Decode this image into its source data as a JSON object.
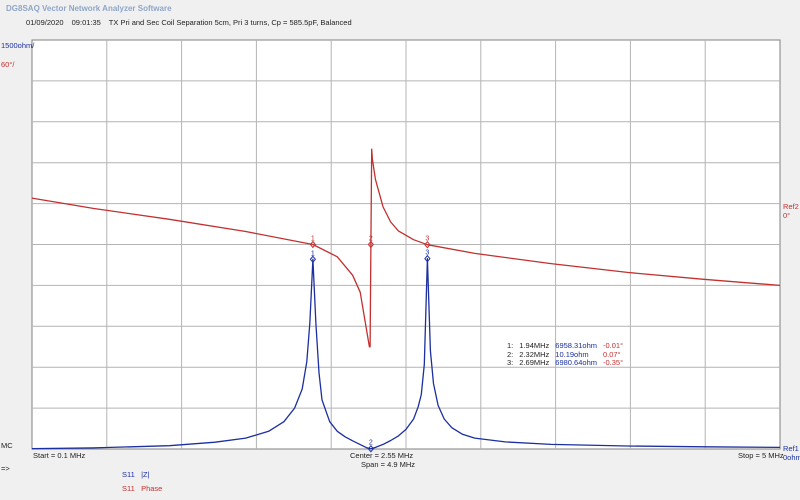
{
  "app_title": "DG8SAQ Vector Network Analyzer Software",
  "header": {
    "date": "01/09/2020",
    "time": "09:01:35",
    "description": "TX Pri and Sec Coil Separation 5cm, Pri 3 turns, Cp = 585.5pF, Balanced"
  },
  "axis_left": {
    "top_primary": "1500ohm/",
    "top_secondary": "60°/",
    "bottom": "MC"
  },
  "axis_right": {
    "ref2_label": "Ref2",
    "ref2_value": "0°",
    "ref1_label": "Ref1",
    "ref1_value": "0ohm"
  },
  "footer": {
    "start": "Start = 0.1 MHz",
    "center": "Center = 2.55 MHz",
    "span": "Span = 4.9 MHz",
    "stop": "Stop = 5 MHz",
    "arrow": "=>"
  },
  "legend": [
    {
      "param": "S11",
      "trace": "|Z|",
      "color": "#1c2fa0"
    },
    {
      "param": "S11",
      "trace": "Phase",
      "color": "#c23030"
    }
  ],
  "markers": [
    {
      "id": "1:",
      "freq": "1.94MHz",
      "magnitude": "6958.31ohm",
      "phase": "-0.01°"
    },
    {
      "id": "2:",
      "freq": "2.32MHz",
      "magnitude": "10.19ohm",
      "phase": "0.07°"
    },
    {
      "id": "3:",
      "freq": "2.69MHz",
      "magnitude": "6980.64ohm",
      "phase": "-0.35°"
    }
  ],
  "chart_data": {
    "type": "line",
    "x_unit": "MHz",
    "xlim": [
      0.1,
      5
    ],
    "grid": true,
    "series": [
      {
        "name": "|Z|",
        "color": "#1c2fa0",
        "ylim": [
          0,
          15000
        ],
        "x": [
          0.1,
          0.5,
          1.0,
          1.3,
          1.5,
          1.65,
          1.75,
          1.82,
          1.87,
          1.9,
          1.92,
          1.94,
          1.96,
          1.98,
          2.0,
          2.05,
          2.1,
          2.15,
          2.2,
          2.25,
          2.29,
          2.32,
          2.35,
          2.4,
          2.45,
          2.5,
          2.55,
          2.6,
          2.63,
          2.65,
          2.67,
          2.69,
          2.71,
          2.73,
          2.76,
          2.8,
          2.85,
          2.92,
          3.0,
          3.2,
          3.5,
          4.0,
          4.5,
          5.0
        ],
        "y": [
          10,
          40,
          120,
          250,
          400,
          650,
          1000,
          1500,
          2200,
          3200,
          4600,
          6958,
          4600,
          2800,
          1800,
          1000,
          650,
          450,
          300,
          160,
          50,
          10,
          60,
          170,
          310,
          480,
          720,
          1100,
          1550,
          2000,
          3100,
          6980,
          3600,
          2400,
          1600,
          1100,
          780,
          540,
          400,
          260,
          170,
          110,
          80,
          60
        ]
      },
      {
        "name": "Phase",
        "color": "#c23030",
        "ylim": [
          -300,
          300
        ],
        "x": [
          0.1,
          0.5,
          1.0,
          1.5,
          1.94,
          2.1,
          2.2,
          2.25,
          2.28,
          2.31,
          2.315,
          2.32,
          2.325,
          2.33,
          2.35,
          2.4,
          2.45,
          2.5,
          2.6,
          2.69,
          3.0,
          3.5,
          4.0,
          4.5,
          5.0
        ],
        "y": [
          68,
          53,
          37,
          19,
          -0.01,
          -18,
          -45,
          -70,
          -110,
          -150,
          -150,
          0.07,
          140,
          125,
          95,
          55,
          33,
          20,
          7,
          -0.35,
          -13,
          -28,
          -41,
          -51,
          -60
        ]
      }
    ],
    "marker_points": [
      {
        "label": "1",
        "x": 1.94,
        "mag": 6958.31,
        "phase": -0.01
      },
      {
        "label": "2",
        "x": 2.32,
        "mag": 10.19,
        "phase": 0.07
      },
      {
        "label": "3",
        "x": 2.69,
        "mag": 6980.64,
        "phase": -0.35
      }
    ]
  }
}
